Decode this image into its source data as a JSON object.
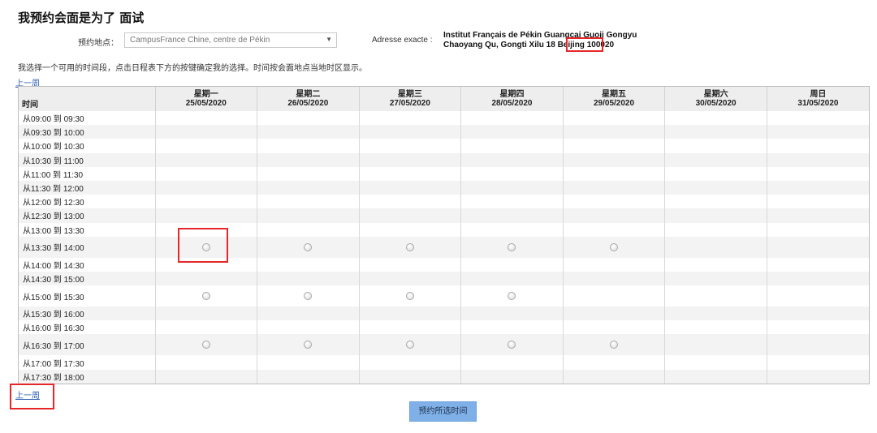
{
  "page": {
    "title": "我预约会面是为了 面试"
  },
  "location": {
    "label": "预约地点：",
    "selected": "CampusFrance Chine, centre de Pékin"
  },
  "address": {
    "label": "Adresse exacte :",
    "line1": "Institut Français de Pékin Guangcai Guoji Gongyu",
    "line2_before": "Chaoyang Qu, Gongti Xilu 18 ",
    "line2_city": "Beijing",
    "line2_after": " 100020"
  },
  "instruction": "我选择一个可用的时间段，点击日程表下方的按键确定我的选择。时间按会面地点当地时区显示。",
  "nav": {
    "prev_week_top": "上一周",
    "prev_week_bottom": "上一周"
  },
  "schedule": {
    "time_header": "时间",
    "days": [
      {
        "name": "星期一",
        "date": "25/05/2020"
      },
      {
        "name": "星期二",
        "date": "26/05/2020"
      },
      {
        "name": "星期三",
        "date": "27/05/2020"
      },
      {
        "name": "星期四",
        "date": "28/05/2020"
      },
      {
        "name": "星期五",
        "date": "29/05/2020"
      },
      {
        "name": "星期六",
        "date": "30/05/2020"
      },
      {
        "name": "周日",
        "date": "31/05/2020"
      }
    ],
    "slots": [
      {
        "time": "从09:00 到 09:30",
        "available": [
          0,
          0,
          0,
          0,
          0,
          0,
          0
        ]
      },
      {
        "time": "从09:30 到 10:00",
        "available": [
          0,
          0,
          0,
          0,
          0,
          0,
          0
        ]
      },
      {
        "time": "从10:00 到 10:30",
        "available": [
          0,
          0,
          0,
          0,
          0,
          0,
          0
        ]
      },
      {
        "time": "从10:30 到 11:00",
        "available": [
          0,
          0,
          0,
          0,
          0,
          0,
          0
        ]
      },
      {
        "time": "从11:00 到 11:30",
        "available": [
          0,
          0,
          0,
          0,
          0,
          0,
          0
        ]
      },
      {
        "time": "从11:30 到 12:00",
        "available": [
          0,
          0,
          0,
          0,
          0,
          0,
          0
        ]
      },
      {
        "time": "从12:00 到 12:30",
        "available": [
          0,
          0,
          0,
          0,
          0,
          0,
          0
        ]
      },
      {
        "time": "从12:30 到 13:00",
        "available": [
          0,
          0,
          0,
          0,
          0,
          0,
          0
        ]
      },
      {
        "time": "从13:00 到 13:30",
        "available": [
          0,
          0,
          0,
          0,
          0,
          0,
          0
        ]
      },
      {
        "time": "从13:30 到 14:00",
        "available": [
          1,
          1,
          1,
          1,
          1,
          0,
          0
        ]
      },
      {
        "time": "从14:00 到 14:30",
        "available": [
          0,
          0,
          0,
          0,
          0,
          0,
          0
        ]
      },
      {
        "time": "从14:30 到 15:00",
        "available": [
          0,
          0,
          0,
          0,
          0,
          0,
          0
        ]
      },
      {
        "time": "从15:00 到 15:30",
        "available": [
          1,
          1,
          1,
          1,
          0,
          0,
          0
        ]
      },
      {
        "time": "从15:30 到 16:00",
        "available": [
          0,
          0,
          0,
          0,
          0,
          0,
          0
        ]
      },
      {
        "time": "从16:00 到 16:30",
        "available": [
          0,
          0,
          0,
          0,
          0,
          0,
          0
        ]
      },
      {
        "time": "从16:30 到 17:00",
        "available": [
          1,
          1,
          1,
          1,
          1,
          0,
          0
        ]
      },
      {
        "time": "从17:00 到 17:30",
        "available": [
          0,
          0,
          0,
          0,
          0,
          0,
          0
        ]
      },
      {
        "time": "从17:30 到 18:00",
        "available": [
          0,
          0,
          0,
          0,
          0,
          0,
          0
        ]
      }
    ]
  },
  "submit_label": "预约所选时间",
  "colors": {
    "highlight": "#e5262a",
    "submit_bg": "#7fb0e8",
    "link": "#2a5db0",
    "header_bg": "#eeeeee"
  }
}
